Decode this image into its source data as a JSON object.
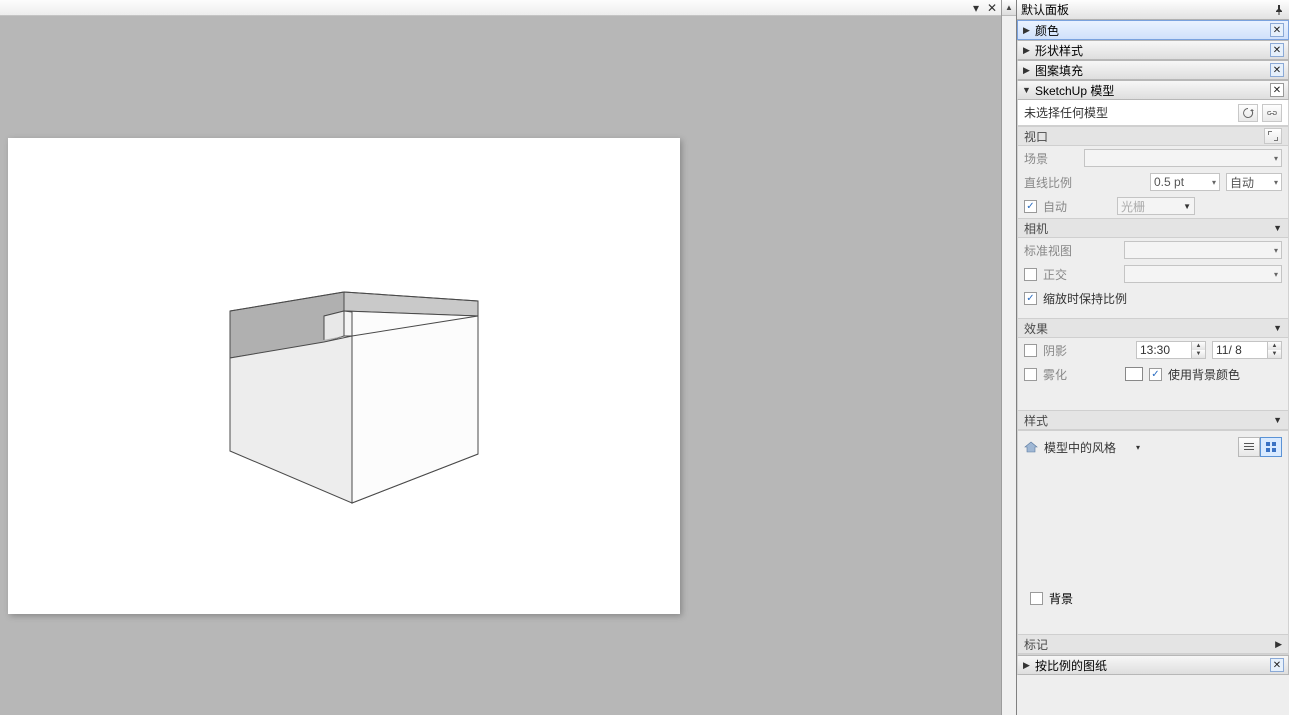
{
  "titlebar": {
    "dropdown": "▾",
    "close": "✕"
  },
  "canvas": {
    "model_name": "3d-box"
  },
  "panel": {
    "title": "默认面板",
    "sections": {
      "color": {
        "label": "颜色",
        "expanded": false
      },
      "shape": {
        "label": "形状样式",
        "expanded": false
      },
      "pattern": {
        "label": "图案填充",
        "expanded": false
      },
      "sketch": {
        "label": "SketchUp 模型",
        "expanded": true
      },
      "scale": {
        "label": "按比例的图纸",
        "expanded": false
      }
    }
  },
  "model": {
    "no_selection": "未选择任何模型"
  },
  "viewport": {
    "header": "视口",
    "scene_label": "场景",
    "line_scale_label": "直线比例",
    "line_scale_value": "0.5 pt",
    "auto_label": "自动",
    "auto2_label": "自动",
    "raster_value": "光栅"
  },
  "camera": {
    "header": "相机",
    "std_view_label": "标准视图",
    "ortho_label": "正交",
    "preserve_scale_label": "缩放时保持比例"
  },
  "effects": {
    "header": "效果",
    "shadow_label": "阴影",
    "shadow_time": "13:30",
    "shadow_date": "11/ 8",
    "fog_label": "雾化",
    "use_bg_color_label": "使用背景颜色"
  },
  "style": {
    "header": "样式",
    "model_style_label": "模型中的风格",
    "bg_label": "背景"
  },
  "tag": {
    "header": "标记"
  }
}
